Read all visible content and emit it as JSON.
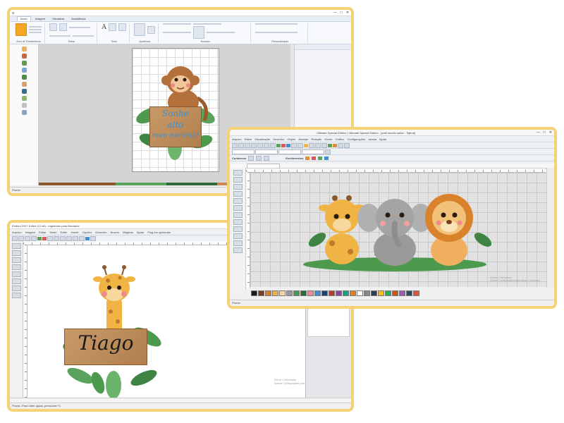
{
  "window1": {
    "tabs": [
      "Início",
      "Imagem",
      "Visualizar",
      "Assistência"
    ],
    "ribbon_groups": [
      "Área de Transferência",
      "Editar",
      "Texto",
      "Aparência",
      "Bordado",
      "Personalização"
    ],
    "design_text": [
      "Sonhe",
      "alto",
      "meu menino!"
    ],
    "status": "Pronto"
  },
  "window2": {
    "title": "Ultimate Special Edition | Ultimate Special Edition - [safé escrito safari - Tajima]",
    "menu": [
      "Arquivo",
      "Editar",
      "Visualização",
      "Desenho",
      "Objeto",
      "Arranjar",
      "Rotação",
      "Monte",
      "Gráfico",
      "Configurações",
      "Janela",
      "Ajuda"
    ],
    "toolbar_labels": [
      "Contornos",
      "Enchimentos"
    ],
    "status": "Pronto",
    "watermark_line1": "Ativar o Windows",
    "watermark_line2": "Acesse Configurações para ativar o Windows."
  },
  "window3": {
    "title": "Embird 2017 Editor (12 bit) - registrado para Bordador",
    "menu": [
      "Arquivo",
      "Imagem",
      "Editar",
      "Modo",
      "Exibir",
      "Inserir",
      "Opções",
      "Desenho",
      "Nuvem",
      "Mágicas",
      "Ajuda",
      "Plug-ins opcionais"
    ],
    "design_text": "Tiago",
    "status": "Pronto. Para obter ajuda, pressione F1",
    "watermark_line1": "Ativar o Windows",
    "watermark_line2": "Acesse Configurações para ativar o Windows."
  },
  "colors": {
    "frame_border": "#f6d277",
    "wood": "#b07f4d",
    "text_blue": "#3f8fd2",
    "leaf_green": "#4d9a4f"
  }
}
